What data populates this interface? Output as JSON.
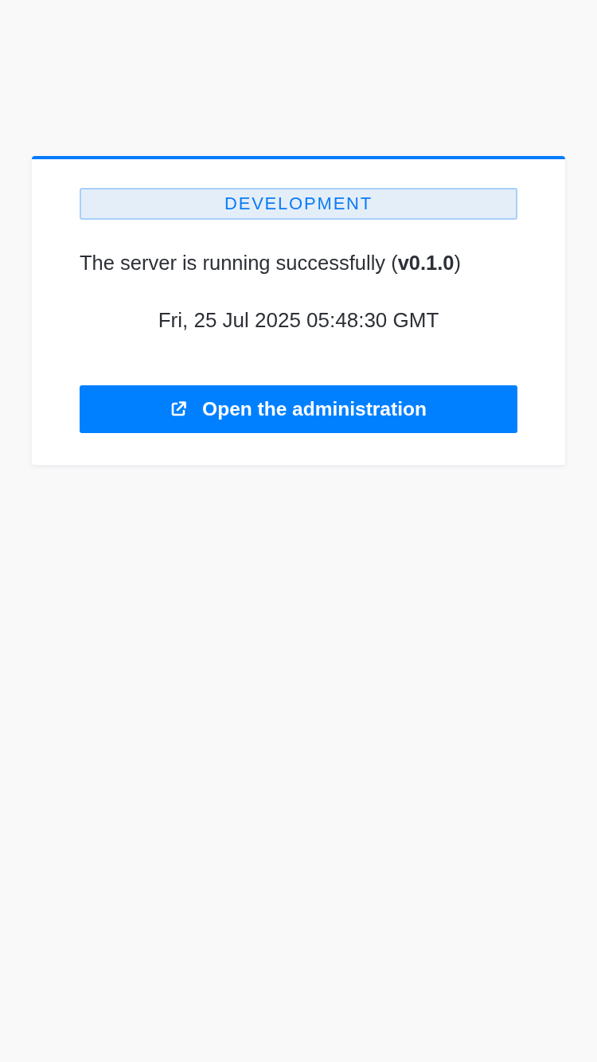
{
  "badge": {
    "label": "DEVELOPMENT"
  },
  "status_message": "The server is running successfully (**v0.1.0**)",
  "timestamp": "Fri, 25 Jul 2025 05:48:30 GMT",
  "action_button": {
    "label": "Open the administration"
  }
}
